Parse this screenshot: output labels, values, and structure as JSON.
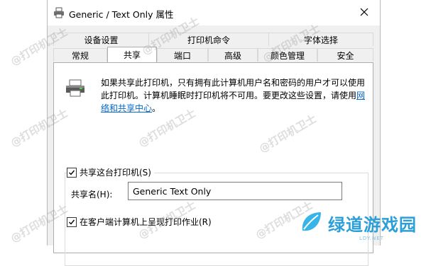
{
  "window": {
    "title": "Generic / Text Only 属性"
  },
  "tabs": {
    "row1": [
      "设备设置",
      "打印机命令",
      "字体选择"
    ],
    "row2": [
      "常规",
      "共享",
      "端口",
      "高级",
      "颜色管理",
      "安全"
    ],
    "selected": "共享"
  },
  "sharing": {
    "info_text": "如果共享此打印机，只有拥有此计算机用户名和密码的用户才可以使用此打印机。计算机睡眠时打印机将不可用。要更改这些设置，请使用",
    "link_text": "网络和共享中心",
    "info_suffix": "。",
    "share_checkbox_label": "共享这台打印机(S)",
    "share_checked": true,
    "share_name_label": "共享名(H):",
    "share_name_value": "Generic  Text Only",
    "render_checkbox_label": "在客户端计算机上呈现打印作业(R)",
    "render_checked": true
  },
  "watermark": {
    "text": "@打印机卫士"
  },
  "logo": {
    "text": "绿道游戏园",
    "sub": "LDY.NET",
    "color": "#2c9fd9"
  }
}
